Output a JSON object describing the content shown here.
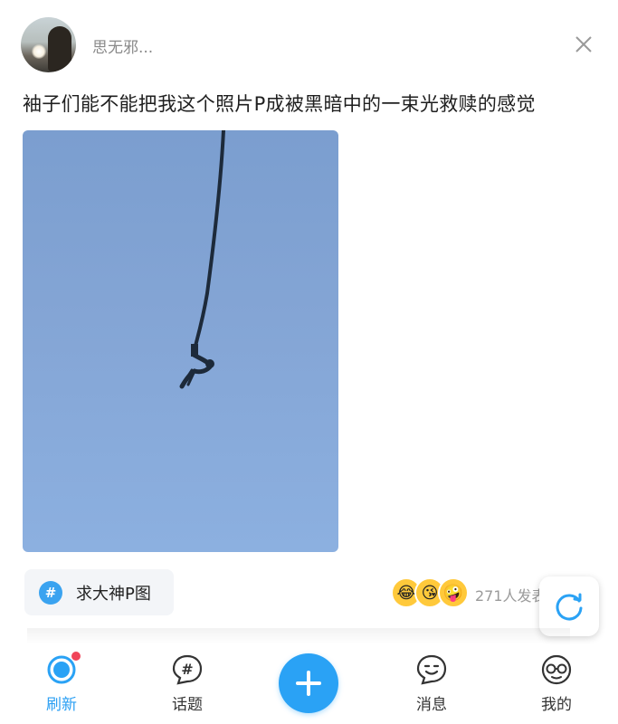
{
  "post": {
    "username": "思无邪...",
    "text": "袖子们能不能把我这个照片P成被黑暗中的一束光救赎的感觉",
    "topic": "求大神P图",
    "topic_icon": "#",
    "reply_count_text": "271人发表",
    "emojis": [
      "😂",
      "😘",
      "🤪"
    ]
  },
  "icons": {
    "close": "close-icon",
    "refresh": "refresh-icon",
    "add": "plus-icon"
  },
  "bottom_nav": {
    "items": [
      {
        "label": "刷新",
        "icon": "refresh-circle-icon",
        "active": true
      },
      {
        "label": "话题",
        "icon": "topic-bubble-icon",
        "active": false
      },
      {
        "label": "消息",
        "icon": "message-face-icon",
        "active": false
      },
      {
        "label": "我的",
        "icon": "profile-glasses-icon",
        "active": false
      }
    ]
  },
  "colors": {
    "accent": "#2aa2f5",
    "badge_red": "#f0455a",
    "sky": "#84a5d5"
  }
}
